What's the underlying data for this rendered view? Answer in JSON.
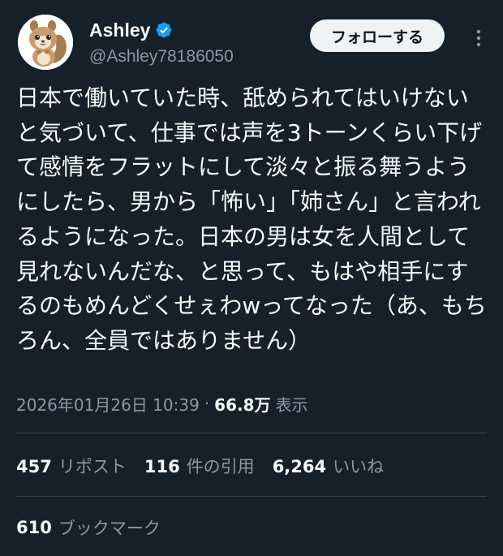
{
  "author": {
    "display_name": "Ashley",
    "handle": "@Ashley78186050",
    "avatar_icon": "squirrel-avatar-icon",
    "verified_icon": "verified-badge-icon"
  },
  "follow_button": {
    "label": "フォローする"
  },
  "more_button": {
    "icon": "more-vertical-icon"
  },
  "tweet": {
    "text": "日本で働いていた時、舐められてはいけないと気づいて、仕事では声を3トーンくらい下げて感情をフラットにして淡々と振る舞うようにしたら、男から「怖い」「姉さん」と言われるようになった。日本の男は女を人間として見れないんだな、と思って、もはや相手にするのもめんどくせぇわwってなった（あ、もちろん、全員ではありません）"
  },
  "meta": {
    "timestamp": "2026年01月26日 10:39",
    "separator": "·",
    "views_count": "66.8万",
    "views_label": "表示"
  },
  "stats": {
    "reposts": {
      "count": "457",
      "label": "リポスト"
    },
    "quotes": {
      "count": "116",
      "label": "件の引用"
    },
    "likes": {
      "count": "6,264",
      "label": "いいね"
    }
  },
  "bookmarks": {
    "count": "610",
    "label": "ブックマーク"
  },
  "colors": {
    "background": "#15202b",
    "text_primary": "#f7f9f9",
    "text_secondary": "#8b98a5",
    "verified_blue": "#1d9bf0",
    "divider": "#38444d",
    "follow_bg": "#eff3f4"
  }
}
